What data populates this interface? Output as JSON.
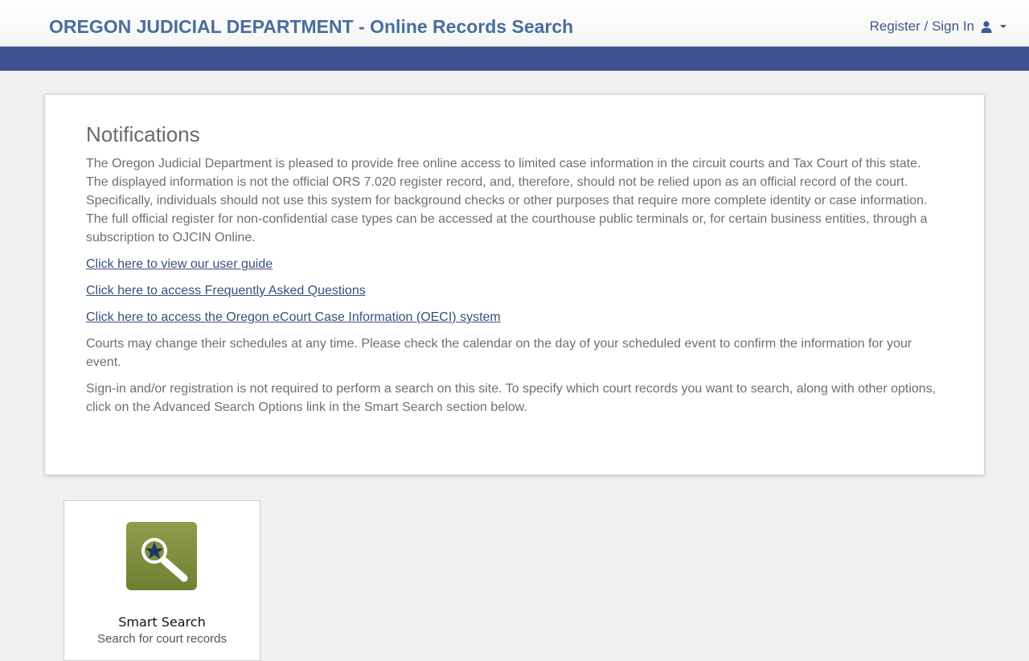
{
  "header": {
    "title": "OREGON JUDICIAL DEPARTMENT - Online Records Search",
    "account_label": "Register / Sign In",
    "account_icon": "user-icon",
    "account_caret": "chevron-down-icon"
  },
  "colors": {
    "title": "#4a6d9c",
    "band": "#3f528f",
    "link": "#3a4f7c",
    "tile_icon_bg": "#7f8f3f"
  },
  "notifications": {
    "title": "Notifications",
    "intro": "The Oregon Judicial Department is pleased to provide free online access to limited case information in the circuit courts and Tax Court of this state. The displayed information is not the official ORS 7.020 register record, and, therefore, should not be relied upon as an official record of the court. Specifically, individuals should not use this system for background checks or other purposes that require more complete identity or case information. The full official register for non-confidential case types can be accessed at the courthouse public terminals or, for certain business entities, through a subscription to OJCIN Online.",
    "links": [
      "Click here to view our user guide",
      "Click here to access Frequently Asked Questions",
      "Click here to access the Oregon eCourt Case Information (OECI) system"
    ],
    "schedule_note": "Courts may change their schedules at any time. Please check the calendar on the day of your scheduled event to confirm the information for your event.",
    "signin_note": "Sign-in and/or registration is not required to perform a search on this site. To specify which court records you want to search, along with other options, click on the Advanced Search Options link in the Smart Search section below."
  },
  "tiles": [
    {
      "title": "Smart Search",
      "subtitle": "Search for court records",
      "icon": "magnifier-star-icon"
    }
  ]
}
